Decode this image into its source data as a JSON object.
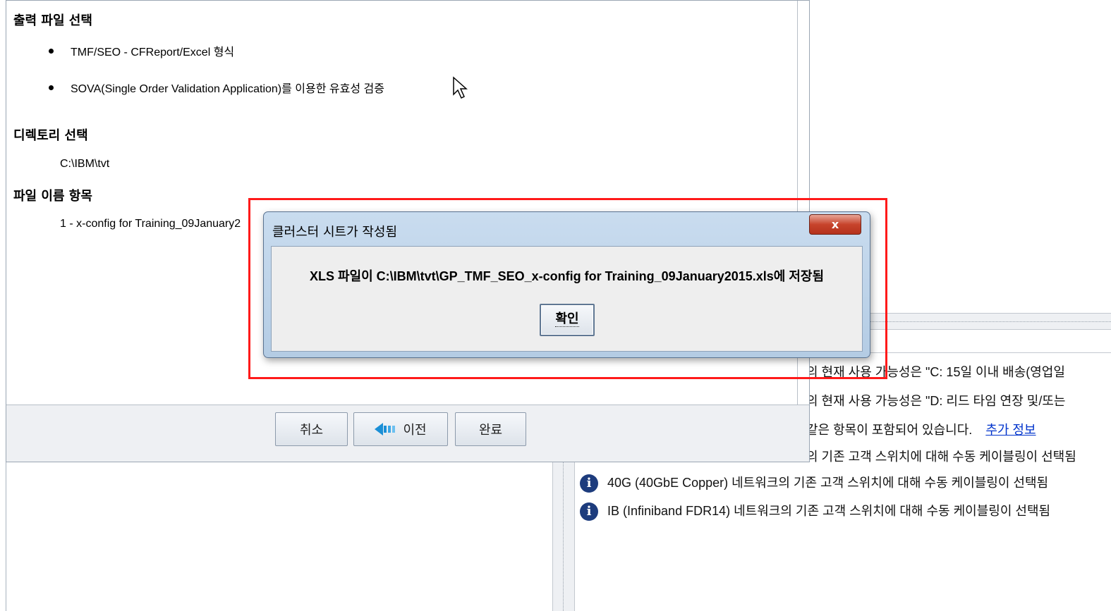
{
  "wizard": {
    "output_section_title": "출력 파일 선택",
    "output_options": [
      "TMF/SEO - CFReport/Excel 형식",
      "SOVA(Single Order Validation Application)를 이용한 유효성 검증"
    ],
    "directory_section_title": "디렉토리 선택",
    "directory_value": "C:\\IBM\\tvt",
    "filename_section_title": "파일 이름 항목",
    "filename_value": "1 - x-config for Training_09January2",
    "buttons": {
      "cancel": "취소",
      "previous": "이전",
      "finish": "완료"
    }
  },
  "dialog": {
    "title": "클러스터 시트가 작성됨",
    "close_label": "x",
    "message": "XLS 파일이 C:\\IBM\\tvt\\GP_TMF_SEO_x-config for Training_09January2015.xls에 저장됨",
    "ok_label": "확인"
  },
  "background_messages": {
    "rows": [
      "의 현재 사용 가능성은 \"C: 15일 이내 배송(영업일",
      "의 현재 사용 가능성은 \"D: 리드 타임 연장 및/또는",
      "같은 항목이 포함되어 있습니다.",
      "의 기존 고객 스위치에 대해 수동 케이블링이 선택됨",
      "40G (40GbE Copper) 네트워크의 기존 고객 스위치에 대해 수동 케이블링이 선택됨",
      "IB (Infiniband FDR14) 네트워크의 기존 고객 스위치에 대해 수동 케이블링이 선택됨"
    ],
    "more_info_link": "추가 정보"
  },
  "colors": {
    "highlight": "#ff1a1a",
    "dialog_frame": "#b4cce4",
    "close_button": "#c7442c",
    "info_icon": "#1d3c7d",
    "link": "#0033cc"
  },
  "icons": {
    "bullet": "bullet-dot",
    "info": "info-icon",
    "previous": "arrow-left-icon",
    "cursor": "mouse-pointer-icon",
    "close": "close-icon"
  }
}
